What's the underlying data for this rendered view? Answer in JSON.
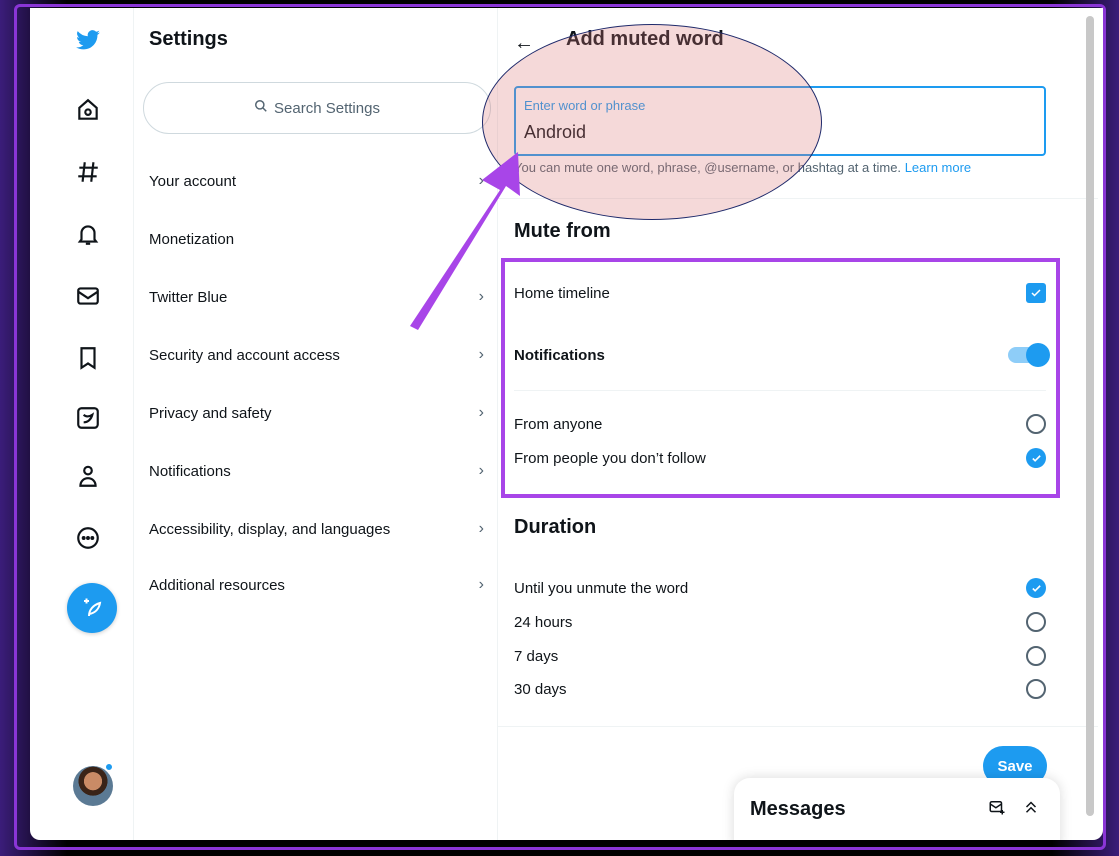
{
  "sidebar": {
    "compose_icon": "feather-plus-icon",
    "icons": [
      "twitter-bird-icon",
      "home-icon",
      "hashtag-icon",
      "bell-icon",
      "envelope-icon",
      "bookmark-icon",
      "twitter-blue-icon",
      "profile-icon",
      "more-icon"
    ]
  },
  "settings": {
    "title": "Settings",
    "search_placeholder": "Search Settings",
    "items": [
      {
        "label": "Your account"
      },
      {
        "label": "Monetization"
      },
      {
        "label": "Twitter Blue"
      },
      {
        "label": "Security and account access"
      },
      {
        "label": "Privacy and safety"
      },
      {
        "label": "Notifications"
      },
      {
        "label": "Accessibility, display, and languages"
      },
      {
        "label": "Additional resources"
      }
    ]
  },
  "detail": {
    "title": "Add muted word",
    "input_label": "Enter word or phrase",
    "input_value": "Android",
    "hint": "You can mute one word, phrase, @username, or hashtag at a time.",
    "learn_more": "Learn more",
    "mute_from_title": "Mute from",
    "home_timeline": "Home timeline",
    "notifications": "Notifications",
    "from_anyone": "From anyone",
    "from_people": "From people you don’t follow",
    "duration_title": "Duration",
    "durations": [
      "Until you unmute the word",
      "24 hours",
      "7 days",
      "30 days"
    ],
    "save": "Save"
  },
  "messages": {
    "title": "Messages"
  },
  "colors": {
    "accent": "#1d9bf0",
    "annotation": "#a845e8"
  }
}
